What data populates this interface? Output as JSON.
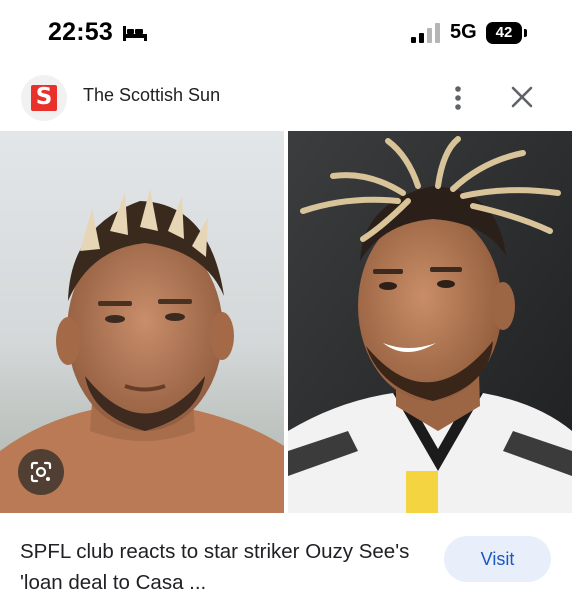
{
  "status_bar": {
    "time": "22:53",
    "network": "5G",
    "battery": "42",
    "icons": [
      "bed-icon",
      "signal-icon",
      "battery-icon"
    ]
  },
  "source": {
    "logo_letter": "S",
    "name": "The Scottish Sun",
    "brand_color": "#e8312a",
    "icons": [
      "more-vert-icon",
      "close-icon"
    ]
  },
  "images": {
    "left_alt": "Man with bleached-tip cropped hair",
    "right_alt": "Footballer with blond dreadlocks in black and white kit",
    "lens_icon": "google-lens-icon"
  },
  "article": {
    "headline": "SPFL club reacts to star striker Ouzy See's 'loan deal to Casa ...",
    "visit_label": "Visit",
    "accent_color": "#1a56c4"
  }
}
